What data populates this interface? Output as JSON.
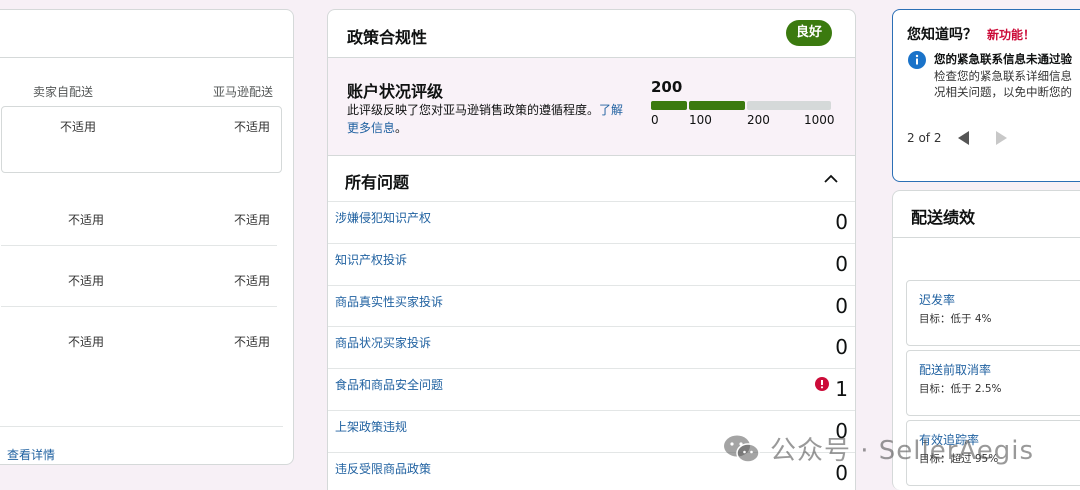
{
  "left_card": {
    "col_seller": "卖家自配送",
    "col_amazon": "亚马逊配送",
    "rows": [
      {
        "seller": "不适用",
        "amazon": "不适用"
      },
      {
        "seller": "不适用",
        "amazon": "不适用"
      },
      {
        "seller": "不适用",
        "amazon": "不适用"
      },
      {
        "seller": "不适用",
        "amazon": "不适用"
      }
    ],
    "view_details": "查看详情"
  },
  "policy": {
    "title": "政策合规性",
    "status": "良好",
    "status_color": "#3b7a0f",
    "ahr_title": "账户状况评级",
    "ahr_desc_prefix": "此评级反映了您对亚马逊销售政策的遵循程度。",
    "ahr_desc_link": "了解更多信息",
    "ahr_desc_suffix": "。",
    "score": "200",
    "scale_ticks": [
      "0",
      "100",
      "200",
      "1000"
    ],
    "issues_title": "所有问题",
    "issues": [
      {
        "label": "涉嫌侵犯知识产权",
        "count": "0",
        "alert": false
      },
      {
        "label": "知识产权投诉",
        "count": "0",
        "alert": false
      },
      {
        "label": "商品真实性买家投诉",
        "count": "0",
        "alert": false
      },
      {
        "label": "商品状况买家投诉",
        "count": "0",
        "alert": false
      },
      {
        "label": "食品和商品安全问题",
        "count": "1",
        "alert": true
      },
      {
        "label": "上架政策违规",
        "count": "0",
        "alert": false
      },
      {
        "label": "违反受限商品政策",
        "count": "0",
        "alert": false
      }
    ]
  },
  "tip": {
    "title": "您知道吗？",
    "badge": "新功能！",
    "bold_line": "您的紧急联系信息未通过验",
    "line2": "检查您的紧急联系详细信息",
    "line3": "况相关问题，以免中断您的",
    "pager": "2 of 2"
  },
  "shipping": {
    "title": "配送绩效",
    "metrics": [
      {
        "name": "迟发率",
        "target": "目标：低于 4%"
      },
      {
        "name": "配送前取消率",
        "target": "目标：低于 2.5%"
      },
      {
        "name": "有效追踪率",
        "target": "目标：超过 95%"
      }
    ]
  },
  "watermark": {
    "text": "公众号 · SellerAegis"
  },
  "colors": {
    "accent": "#2162a1",
    "good": "#3b7a0f",
    "alert": "#cc0c39"
  }
}
